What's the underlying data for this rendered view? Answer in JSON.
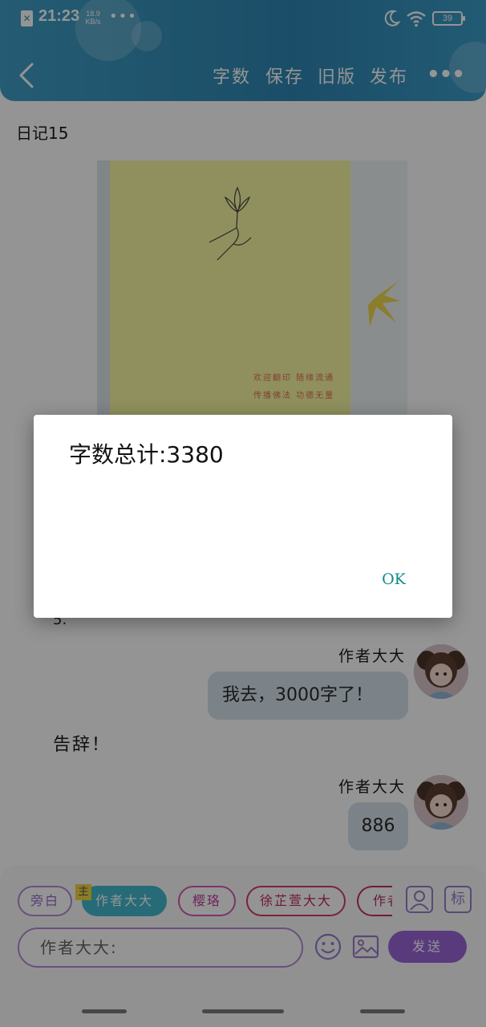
{
  "status_bar": {
    "sim_glyph": "✕",
    "time": "21:23",
    "net_speed_value": "18.9",
    "net_speed_unit": "KB/s",
    "dots": "•••",
    "battery": "39"
  },
  "nav": {
    "word_count": "字数",
    "save": "保存",
    "old_version": "旧版",
    "publish": "发布",
    "more": "•••"
  },
  "document": {
    "title": "日记15",
    "photo_caption_line1": "欢迎翻印  随缘流通",
    "photo_caption_line2": "传播佛法  功德无量"
  },
  "chat": {
    "left_stub": "5.",
    "messages": [
      {
        "sender": "作者大大",
        "text": "我去，3000字了！"
      },
      {
        "sender": "作者大大",
        "text": "886"
      }
    ],
    "narration": "告辞！"
  },
  "input_panel": {
    "roles": [
      "旁白",
      "作者大大",
      "樱珞",
      "徐芷萱大大",
      "作者"
    ],
    "main_badge": "主",
    "tag_button": "标",
    "input_placeholder": "作者大大:",
    "send": "发送"
  },
  "dialog": {
    "message": "字数总计:3380",
    "ok": "OK"
  },
  "colors": {
    "header": "#2f86b3",
    "accent_teal": "#44b8cf",
    "send_purple": "#9a66d8",
    "ok_text": "#138a8a"
  }
}
